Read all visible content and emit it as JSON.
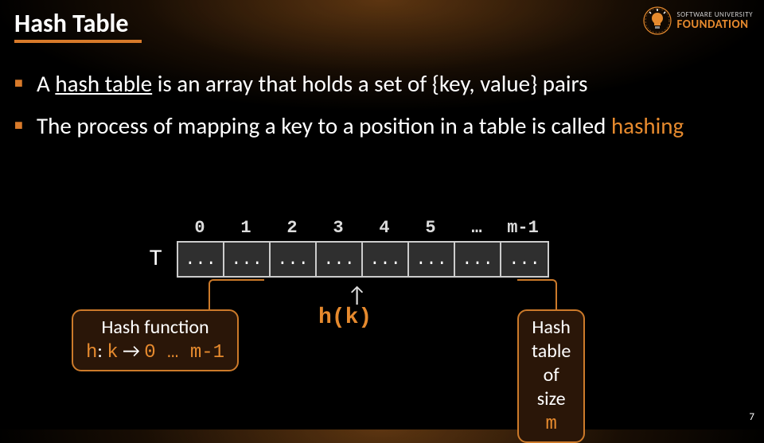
{
  "title": "Hash Table",
  "logo": {
    "line1": "SOFTWARE UNIVERSITY",
    "line2": "FOUNDATION"
  },
  "bullets": {
    "b1_pre": "A ",
    "b1_ul": "hash table",
    "b1_post": " is an array that holds a set of {key, value} pairs",
    "b2_pre": "The process of mapping a key to a position in a table is called ",
    "b2_orange": "hashing"
  },
  "table": {
    "label": "T",
    "indices": [
      "0",
      "1",
      "2",
      "3",
      "4",
      "5",
      "…",
      "m-1"
    ],
    "cells": [
      "...",
      "...",
      "...",
      "...",
      "...",
      "...",
      "...",
      "..."
    ]
  },
  "hk": "h(k)",
  "callout_left": {
    "line1": "Hash function",
    "line2_h": "h",
    "line2_mid": ": ",
    "line2_k": "k",
    "line2_arrow": " → ",
    "line2_range": "0 … m-1"
  },
  "callout_right": {
    "line1": "Hash table",
    "line2_pre": "of size ",
    "line2_m": "m"
  },
  "page": "7"
}
